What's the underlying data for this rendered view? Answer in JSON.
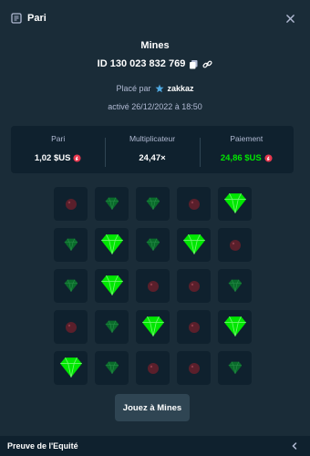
{
  "header": {
    "title": "Pari"
  },
  "bet": {
    "game": "Mines",
    "id_label": "ID 130 023 832 769",
    "placed_by": "Placé par",
    "username": "zakkaz",
    "activated": "activé 26/12/2022 à 18:50"
  },
  "stats": [
    {
      "label": "Pari",
      "value": "1,02 $US"
    },
    {
      "label": "Multiplicateur",
      "value": "24,47×"
    },
    {
      "label": "Paiement",
      "value": "24,86 $US"
    }
  ],
  "board": [
    [
      "mine",
      "gem",
      "gem",
      "mine",
      "gem-revealed"
    ],
    [
      "gem",
      "gem-revealed",
      "gem",
      "gem-revealed",
      "mine"
    ],
    [
      "gem",
      "gem-revealed",
      "mine",
      "mine",
      "gem"
    ],
    [
      "mine",
      "gem",
      "gem-revealed",
      "mine",
      "gem-revealed"
    ],
    [
      "gem-revealed",
      "gem",
      "mine",
      "mine",
      "gem"
    ]
  ],
  "play_button": "Jouez à Mines",
  "footer": {
    "label": "Preuve de l'Equité"
  },
  "colors": {
    "background": "#1a2c38",
    "panel": "#0f212e",
    "button": "#2f4553",
    "muted_text": "#b1bad3",
    "win_green": "#00e701",
    "gem_bright": "#00e701",
    "gem_dim": "#0a6b2b",
    "mine_dim": "#5a1f2b"
  },
  "icons": {
    "header": "receipt-icon",
    "close": "close-icon",
    "copy": "copy-icon",
    "link": "link-icon",
    "user": "star-badge-icon",
    "currency": "coin-icon",
    "footer": "chevron-left-icon"
  }
}
